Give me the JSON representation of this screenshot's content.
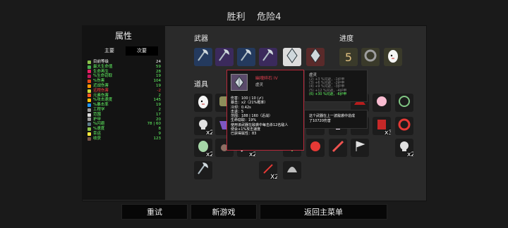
{
  "header": {
    "title": "胜利",
    "danger": "危险4"
  },
  "stats": {
    "title": "属性",
    "tab_primary": "主要",
    "tab_secondary": "次要",
    "rows": [
      {
        "name": "目前等级",
        "value": "24",
        "icon_color": "#8bc34a",
        "name_color": "#ffffff",
        "value_color": "#ffffff"
      },
      {
        "name": "最大生命值",
        "value": "59",
        "icon_color": "#4caf50",
        "name_color": "#66ff66",
        "value_color": "#66ff66"
      },
      {
        "name": "生命再生",
        "value": "28",
        "icon_color": "#e91e63",
        "name_color": "#66ff66",
        "value_color": "#66ff66"
      },
      {
        "name": "%生命窃取",
        "value": "19",
        "icon_color": "#c2185b",
        "name_color": "#66ff66",
        "value_color": "#66ff66"
      },
      {
        "name": "%伤害",
        "value": "104",
        "icon_color": "#e64a19",
        "name_color": "#66ff66",
        "value_color": "#66ff66"
      },
      {
        "name": "近战伤害",
        "value": "19",
        "icon_color": "#ff9800",
        "name_color": "#66ff66",
        "value_color": "#66ff66"
      },
      {
        "name": "远程伤害",
        "value": "-2",
        "icon_color": "#cddc39",
        "name_color": "#ff4444",
        "value_color": "#ff4444"
      },
      {
        "name": "元素伤害",
        "value": "2",
        "icon_color": "#ff5722",
        "name_color": "#66ff66",
        "value_color": "#66ff66"
      },
      {
        "name": "%攻击速度",
        "value": "145",
        "icon_color": "#ffc107",
        "name_color": "#66ff66",
        "value_color": "#66ff66"
      },
      {
        "name": "%暴击率",
        "value": "19",
        "icon_color": "#2196f3",
        "name_color": "#66ff66",
        "value_color": "#66ff66"
      },
      {
        "name": "工程学",
        "value": "2",
        "icon_color": "#9e9e9e",
        "name_color": "#66ff66",
        "value_color": "#66ff66"
      },
      {
        "name": "范围",
        "value": "17",
        "icon_color": "#e0e0e0",
        "name_color": "#66ff66",
        "value_color": "#66ff66"
      },
      {
        "name": "护甲",
        "value": "20",
        "icon_color": "#9e9e9e",
        "name_color": "#66ff66",
        "value_color": "#66ff66"
      },
      {
        "name": "%闪避",
        "value": "78 | 60",
        "icon_color": "#607d8b",
        "name_color": "#66ff66",
        "value_color": "#66ff66"
      },
      {
        "name": "%速度",
        "value": "8",
        "icon_color": "#8bc34a",
        "name_color": "#66ff66",
        "value_color": "#66ff66"
      },
      {
        "name": "幸运",
        "value": "9",
        "icon_color": "#ffeb3b",
        "name_color": "#66ff66",
        "value_color": "#66ff66"
      },
      {
        "name": "收获",
        "value": "123",
        "icon_color": "#795548",
        "name_color": "#66ff66",
        "value_color": "#66ff66"
      }
    ]
  },
  "sections": {
    "weapons": "武器",
    "progress": "进度",
    "items": "道具"
  },
  "weapons": [
    {
      "icon": "axe-icon",
      "tier": "blue"
    },
    {
      "icon": "axe-icon",
      "tier": "purple"
    },
    {
      "icon": "axe-icon",
      "tier": "blue"
    },
    {
      "icon": "axe-icon",
      "tier": "purple"
    },
    {
      "icon": "crystal-leaf-icon",
      "tier": "legendary"
    },
    {
      "icon": "crystal-leaf-icon",
      "tier": "red"
    }
  ],
  "progress": [
    {
      "icon": "number-5-icon",
      "label": "5"
    },
    {
      "icon": "ring-icon",
      "label": ""
    },
    {
      "icon": "egg-icon",
      "label": ""
    }
  ],
  "items": [
    {
      "icon": "egg-icon",
      "count": ""
    },
    {
      "icon": "barrel-icon",
      "count": ""
    },
    {
      "icon": "goo-icon",
      "count": ""
    },
    {
      "icon": "skull-icon",
      "count": "x2"
    },
    {
      "icon": "scarf-icon",
      "count": ""
    },
    {
      "icon": "plant-icon",
      "count": ""
    },
    {
      "icon": "alien-icon",
      "count": "x2"
    },
    {
      "icon": "paw-icon",
      "count": ""
    },
    {
      "icon": "sword-icon",
      "count": "x2"
    },
    {
      "icon": "jelly-icon",
      "count": ""
    },
    {
      "icon": "wreath-icon",
      "count": ""
    },
    {
      "icon": "book-icon",
      "count": "x3"
    },
    {
      "icon": "gem-ring-icon",
      "count": ""
    },
    {
      "icon": "skull-icon",
      "count": "x2"
    },
    {
      "icon": "dragon-icon",
      "count": ""
    },
    {
      "icon": "lamp-icon",
      "count": ""
    },
    {
      "icon": "candle-icon",
      "count": ""
    },
    {
      "icon": "snake-icon",
      "count": ""
    },
    {
      "icon": "flag-icon",
      "count": ""
    },
    {
      "icon": "plant-icon",
      "count": ""
    },
    {
      "icon": "tooth-icon",
      "count": ""
    },
    {
      "icon": "syringe-icon",
      "count": ""
    },
    {
      "icon": "axe-icon",
      "count": ""
    },
    {
      "icon": "dagger-icon",
      "count": "X2"
    },
    {
      "icon": "helmet-icon",
      "count": ""
    }
  ],
  "tooltip": {
    "name": "幽魂碎石 IV",
    "type": "虚灵",
    "lines": [
      "伤害：100 | 10 (〆)",
      "暴击：x2（21%概率）",
      "冷却：0.42s",
      "击退：5",
      "范围：188 | 160（近战）",
      "生命窃取：19%",
      "使用该武器在敌袭中每击杀12名敌人",
      "便会+1%攻击速度",
      "已获得属性：83"
    ]
  },
  "tooltip2": {
    "title": "虚灵",
    "lines": [
      "(2) +3 %闪避，-1护甲",
      "(3) +6 %闪避，-2护甲",
      "(4) +9 %闪避，-3护甲",
      "(5) +12 %闪避，-4护甲",
      "(6) +30 %闪避，-6护甲"
    ]
  },
  "tooltip3": {
    "lines": [
      "这个武器在上一波敌袭中造成",
      "了10720伤害"
    ]
  },
  "buttons": {
    "retry": "重试",
    "new_game": "新游戏",
    "main_menu": "返回主菜单"
  }
}
